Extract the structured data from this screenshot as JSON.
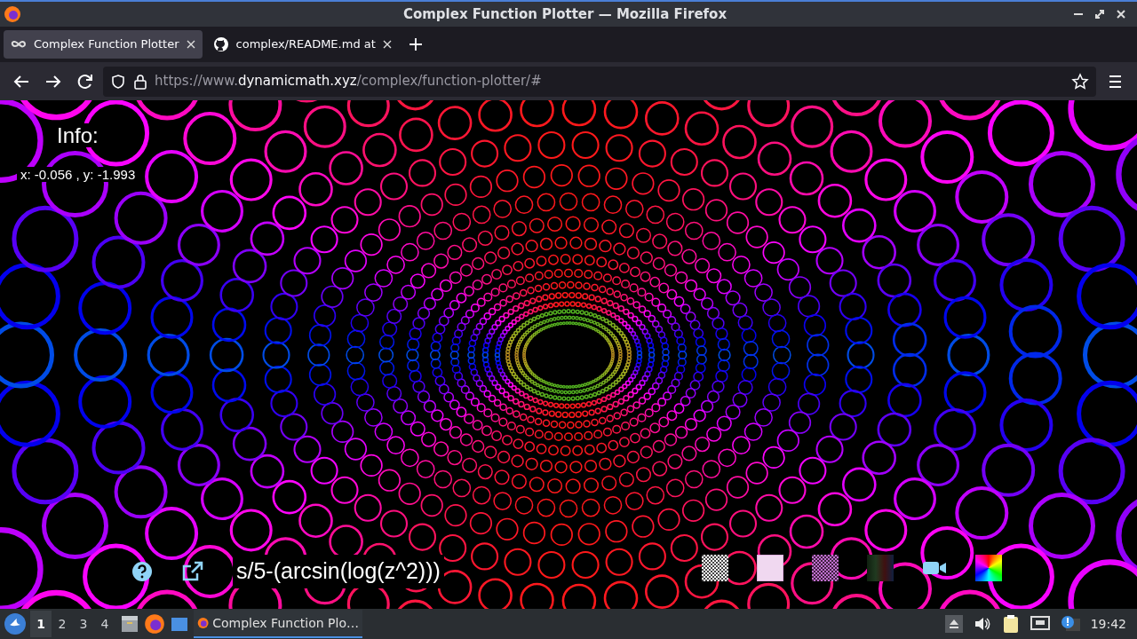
{
  "window": {
    "title": "Complex Function Plotter — Mozilla Firefox"
  },
  "tabs": [
    {
      "label": "Complex Function Plotter",
      "selected": true
    },
    {
      "label": "complex/README.md at",
      "selected": false
    }
  ],
  "url": {
    "prefix": "https://www.",
    "domain": "dynamicmath.xyz",
    "path": "/complex/function-plotter/#"
  },
  "page": {
    "info_title": "Info:",
    "coordinates": "x: -0.056 , y: -1.993",
    "expression": "s/5-(arcsin(log(z^2)))"
  },
  "taskbar": {
    "workspaces": [
      {
        "label": "1",
        "selected": true
      },
      {
        "label": "2",
        "selected": false
      },
      {
        "label": "3",
        "selected": false
      },
      {
        "label": "4",
        "selected": false
      }
    ],
    "task": "Complex Function Plo…",
    "clock": "19:42"
  }
}
